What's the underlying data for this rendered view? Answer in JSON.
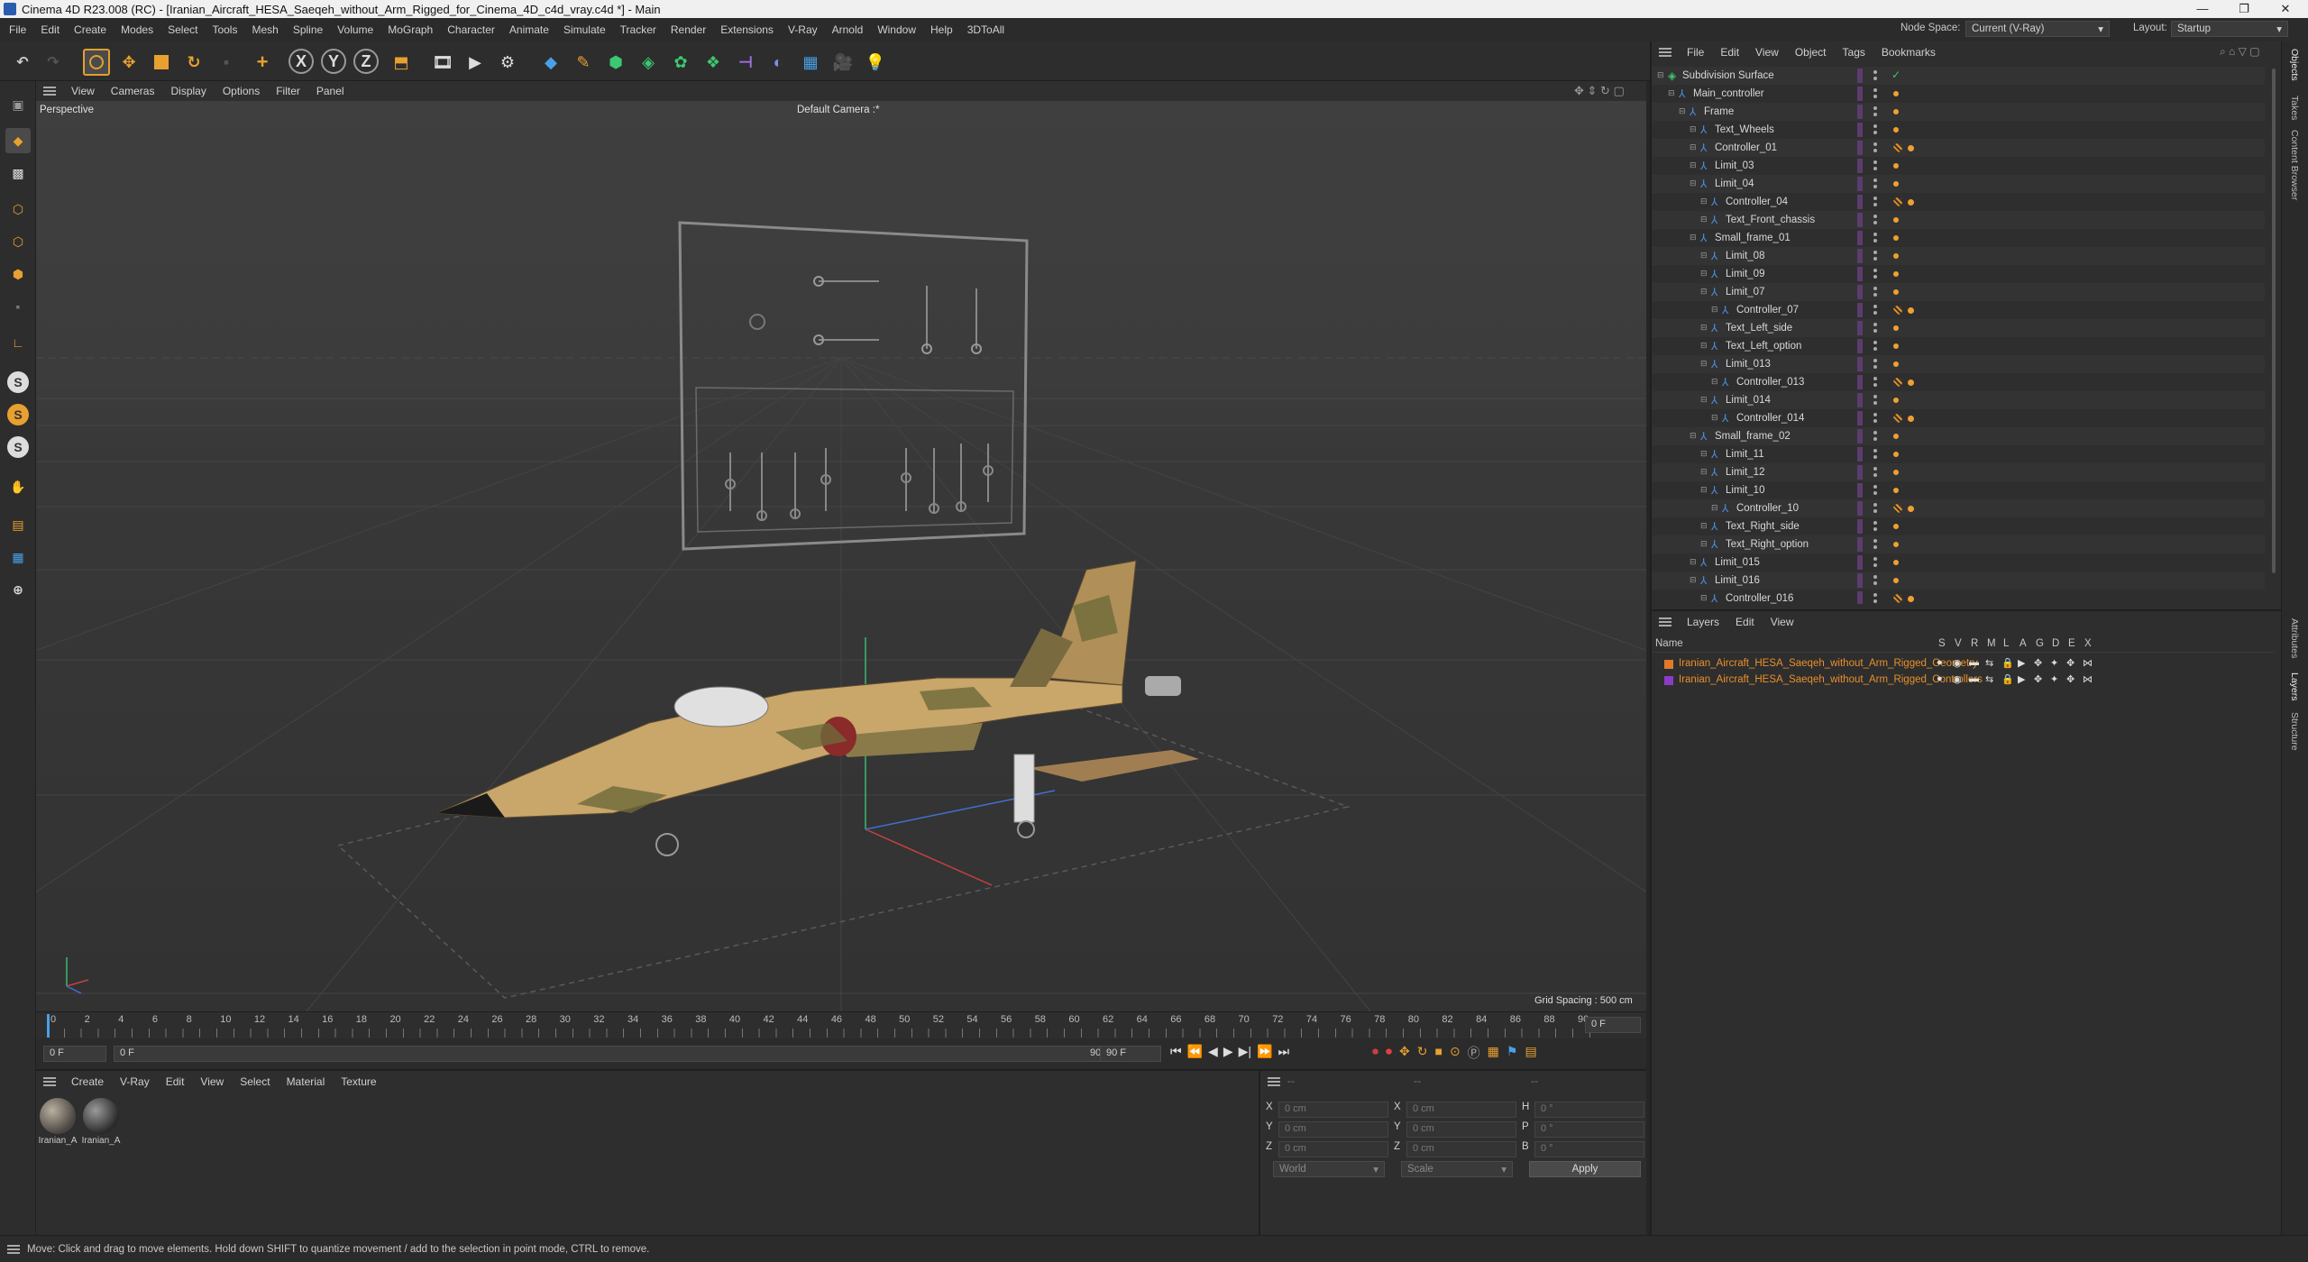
{
  "window": {
    "title": "Cinema 4D R23.008 (RC) - [Iranian_Aircraft_HESA_Saeqeh_without_Arm_Rigged_for_Cinema_4D_c4d_vray.c4d *] - Main",
    "controls": [
      "—",
      "❐",
      "✕"
    ]
  },
  "menubar": {
    "items": [
      "File",
      "Edit",
      "Create",
      "Modes",
      "Select",
      "Tools",
      "Mesh",
      "Spline",
      "Volume",
      "MoGraph",
      "Character",
      "Animate",
      "Simulate",
      "Tracker",
      "Render",
      "Extensions",
      "V-Ray",
      "Arnold",
      "Window",
      "Help",
      "3DToAll"
    ],
    "node_space_label": "Node Space:",
    "node_space_value": "Current (V-Ray)",
    "layout_label": "Layout:",
    "layout_value": "Startup"
  },
  "toolbar": {
    "axis_x": "X",
    "axis_y": "Y",
    "axis_z": "Z"
  },
  "left_toolbar": {
    "s_labels": [
      "S",
      "S",
      "S"
    ]
  },
  "viewport": {
    "menu": [
      "View",
      "Cameras",
      "Display",
      "Options",
      "Filter",
      "Panel"
    ],
    "view_name": "Perspective",
    "camera_name": "Default Camera",
    "camera_suffix": ":*",
    "grid_spacing": "Grid Spacing : 500 cm"
  },
  "timeline": {
    "frames": [
      "0",
      "2",
      "4",
      "6",
      "8",
      "10",
      "12",
      "14",
      "16",
      "18",
      "20",
      "22",
      "24",
      "26",
      "28",
      "30",
      "32",
      "34",
      "36",
      "38",
      "40",
      "42",
      "44",
      "46",
      "48",
      "50",
      "52",
      "54",
      "56",
      "58",
      "60",
      "62",
      "64",
      "66",
      "68",
      "70",
      "72",
      "74",
      "76",
      "78",
      "80",
      "82",
      "84",
      "86",
      "88",
      "90"
    ],
    "current_frame": "0 F",
    "end_display": "0 F"
  },
  "transport": {
    "start_field": "0 F",
    "range_start": "0 F",
    "range_end": "90 F",
    "end_field": "90 F"
  },
  "materials": {
    "menu": [
      "Create",
      "V-Ray",
      "Edit",
      "View",
      "Select",
      "Material",
      "Texture"
    ],
    "items": [
      {
        "label": "Iranian_A"
      },
      {
        "label": "Iranian_A"
      }
    ]
  },
  "attributes": {
    "header_dashes": [
      "--",
      "--",
      "--"
    ],
    "rows": [
      {
        "a": "X",
        "av": "0 cm",
        "b": "X",
        "bv": "0 cm",
        "c": "H",
        "cv": "0 °"
      },
      {
        "a": "Y",
        "av": "0 cm",
        "b": "Y",
        "bv": "0 cm",
        "c": "P",
        "cv": "0 °"
      },
      {
        "a": "Z",
        "av": "0 cm",
        "b": "Z",
        "bv": "0 cm",
        "c": "B",
        "cv": "0 °"
      }
    ],
    "coord_mode": "World",
    "scale_mode": "Scale",
    "apply_label": "Apply"
  },
  "objects": {
    "menu": [
      "File",
      "Edit",
      "View",
      "Object",
      "Tags",
      "Bookmarks"
    ],
    "rows": [
      {
        "name": "Subdivision Surface",
        "depth": 0,
        "icon": "sds",
        "tag": "check"
      },
      {
        "name": "Main_controller",
        "depth": 1,
        "icon": "null",
        "tag": "orange"
      },
      {
        "name": "Frame",
        "depth": 2,
        "icon": "null",
        "tag": "orange"
      },
      {
        "name": "Text_Wheels",
        "depth": 3,
        "icon": "null",
        "tag": "orange"
      },
      {
        "name": "Controller_01",
        "depth": 3,
        "icon": "null",
        "tag": "ctrl"
      },
      {
        "name": "Limit_03",
        "depth": 3,
        "icon": "null",
        "tag": "orange"
      },
      {
        "name": "Limit_04",
        "depth": 3,
        "icon": "null",
        "tag": "orange"
      },
      {
        "name": "Controller_04",
        "depth": 4,
        "icon": "null",
        "tag": "ctrl"
      },
      {
        "name": "Text_Front_chassis",
        "depth": 4,
        "icon": "null",
        "tag": "orange"
      },
      {
        "name": "Small_frame_01",
        "depth": 3,
        "icon": "null",
        "tag": "orange"
      },
      {
        "name": "Limit_08",
        "depth": 4,
        "icon": "null",
        "tag": "orange"
      },
      {
        "name": "Limit_09",
        "depth": 4,
        "icon": "null",
        "tag": "orange"
      },
      {
        "name": "Limit_07",
        "depth": 4,
        "icon": "null",
        "tag": "orange"
      },
      {
        "name": "Controller_07",
        "depth": 5,
        "icon": "null",
        "tag": "ctrl"
      },
      {
        "name": "Text_Left_side",
        "depth": 4,
        "icon": "null",
        "tag": "orange"
      },
      {
        "name": "Text_Left_option",
        "depth": 4,
        "icon": "null",
        "tag": "orange"
      },
      {
        "name": "Limit_013",
        "depth": 4,
        "icon": "null",
        "tag": "orange"
      },
      {
        "name": "Controller_013",
        "depth": 5,
        "icon": "null",
        "tag": "ctrl"
      },
      {
        "name": "Limit_014",
        "depth": 4,
        "icon": "null",
        "tag": "orange"
      },
      {
        "name": "Controller_014",
        "depth": 5,
        "icon": "null",
        "tag": "ctrl"
      },
      {
        "name": "Small_frame_02",
        "depth": 3,
        "icon": "null",
        "tag": "orange"
      },
      {
        "name": "Limit_11",
        "depth": 4,
        "icon": "null",
        "tag": "orange"
      },
      {
        "name": "Limit_12",
        "depth": 4,
        "icon": "null",
        "tag": "orange"
      },
      {
        "name": "Limit_10",
        "depth": 4,
        "icon": "null",
        "tag": "orange"
      },
      {
        "name": "Controller_10",
        "depth": 5,
        "icon": "null",
        "tag": "ctrl"
      },
      {
        "name": "Text_Right_side",
        "depth": 4,
        "icon": "null",
        "tag": "orange"
      },
      {
        "name": "Text_Right_option",
        "depth": 4,
        "icon": "null",
        "tag": "orange"
      },
      {
        "name": "Limit_015",
        "depth": 3,
        "icon": "null",
        "tag": "orange"
      },
      {
        "name": "Limit_016",
        "depth": 3,
        "icon": "null",
        "tag": "orange"
      },
      {
        "name": "Controller_016",
        "depth": 4,
        "icon": "null",
        "tag": "ctrl"
      }
    ]
  },
  "layers": {
    "menu": [
      "Layers",
      "Edit",
      "View"
    ],
    "name_header": "Name",
    "col_headers": [
      "S",
      "V",
      "R",
      "M",
      "L",
      "A",
      "G",
      "D",
      "E",
      "X"
    ],
    "items": [
      {
        "name": "Iranian_Aircraft_HESA_Saeqeh_without_Arm_Rigged_Geometry",
        "color": "#e07a2a"
      },
      {
        "name": "Iranian_Aircraft_HESA_Saeqeh_without_Arm_Rigged_Controllers",
        "color": "#8a3cc8"
      }
    ]
  },
  "right_tabs": [
    "Objects",
    "Takes",
    "Content Browser",
    "Attributes",
    "Layers",
    "Structure"
  ],
  "status": {
    "text": "Move: Click and drag to move elements. Hold down SHIFT to quantize movement / add to the selection in point mode, CTRL to remove."
  }
}
